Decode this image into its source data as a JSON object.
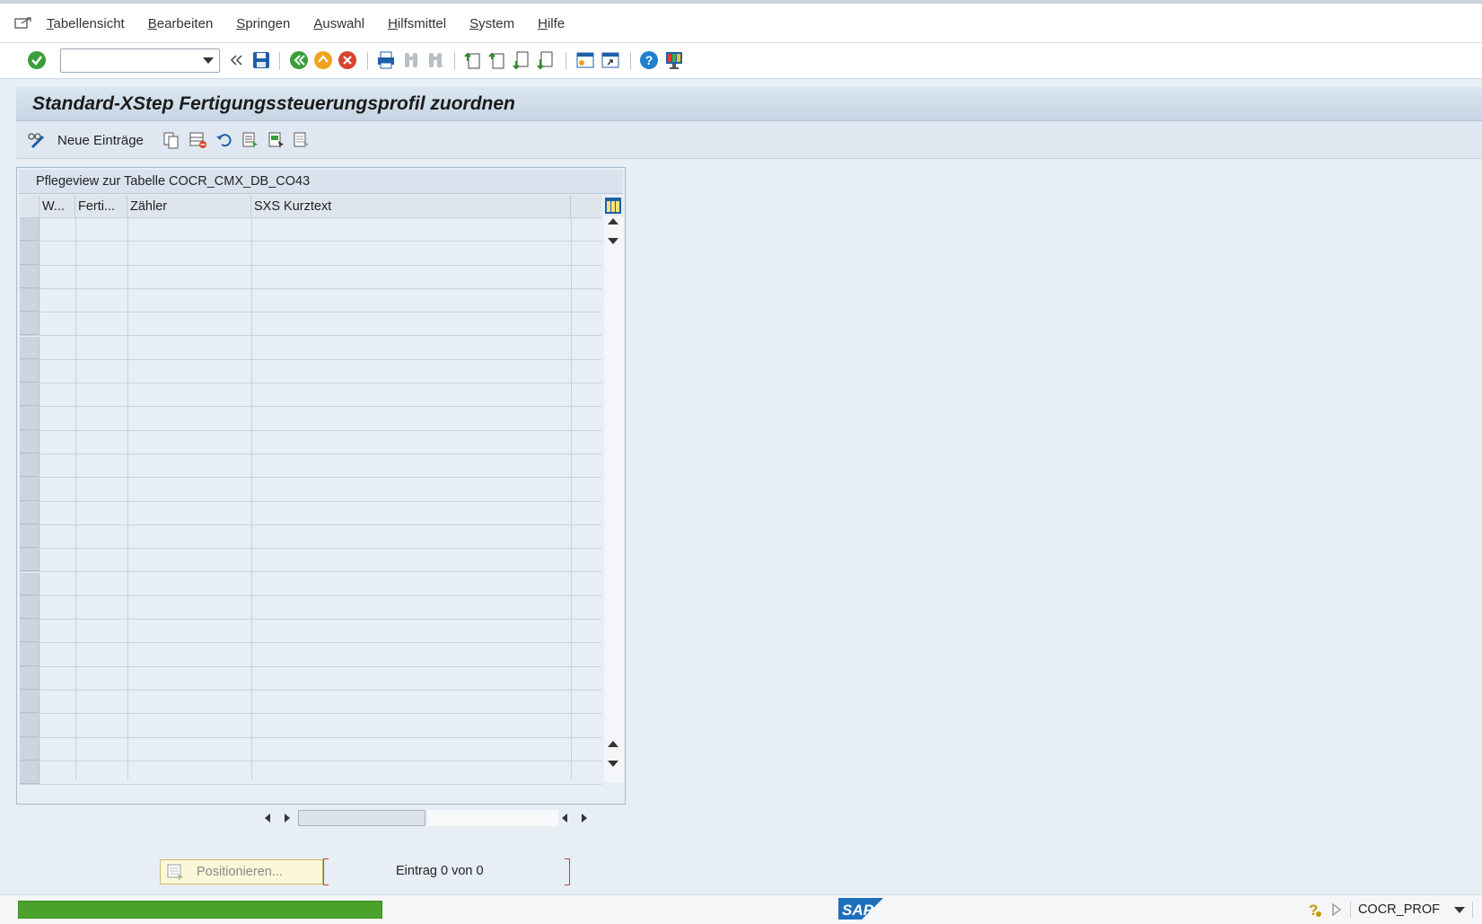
{
  "menu": {
    "items": [
      "Tabellensicht",
      "Bearbeiten",
      "Springen",
      "Auswahl",
      "Hilfsmittel",
      "System",
      "Hilfe"
    ]
  },
  "toolbar": {
    "command_value": "",
    "icons": [
      "enter-icon",
      "back-double-chevron-icon",
      "save-icon",
      "back-icon",
      "exit-icon",
      "cancel-icon",
      "print-icon",
      "find-icon",
      "find-next-icon",
      "first-page-icon",
      "previous-page-icon",
      "next-page-icon",
      "last-page-icon",
      "create-session-icon",
      "shortcut-icon",
      "help-icon",
      "customize-layout-icon"
    ]
  },
  "title": "Standard-XStep Fertigungssteuerungsprofil zuordnen",
  "appbar": {
    "new_entries_label": "Neue Einträge"
  },
  "panel": {
    "title": "Pflegeview zur Tabelle COCR_CMX_DB_CO43",
    "columns": [
      "W...",
      "Ferti...",
      "Zähler",
      "SXS Kurztext"
    ],
    "row_count": 24
  },
  "footer": {
    "position_button": "Positionieren...",
    "entry_text": "Eintrag 0 von 0"
  },
  "status": {
    "logo": "SAP",
    "system": "COCR_PROF"
  },
  "colors": {
    "progress": "#4aa22d",
    "background": "#e8eef5",
    "sap_blue": "#1d6fbd"
  }
}
